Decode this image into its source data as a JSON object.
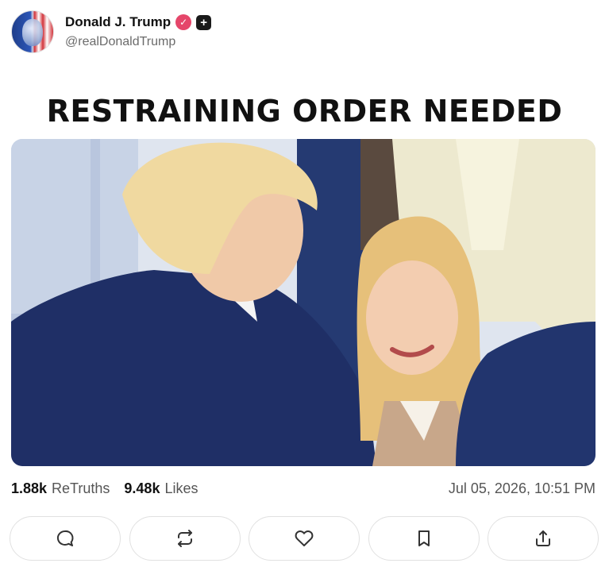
{
  "post": {
    "author": {
      "display_name": "Donald J. Trump",
      "handle": "@realDonaldTrump",
      "verified_icon": "verified-check-icon",
      "badge_icon": "plus-badge-icon"
    },
    "caption": "RESTRAINING ORDER NEEDED",
    "stats": {
      "retruths_count": "1.88k",
      "retruths_label": "ReTruths",
      "likes_count": "9.48k",
      "likes_label": "Likes"
    },
    "timestamp": "Jul 05, 2026, 10:51 PM"
  },
  "actions": [
    {
      "name": "reply-button",
      "icon": "comment-icon"
    },
    {
      "name": "retruth-button",
      "icon": "repost-icon"
    },
    {
      "name": "like-button",
      "icon": "heart-icon"
    },
    {
      "name": "bookmark-button",
      "icon": "bookmark-icon"
    },
    {
      "name": "share-button",
      "icon": "share-icon"
    }
  ],
  "colors": {
    "verified": "#e5466a",
    "text_primary": "#111111",
    "text_secondary": "#555555"
  }
}
